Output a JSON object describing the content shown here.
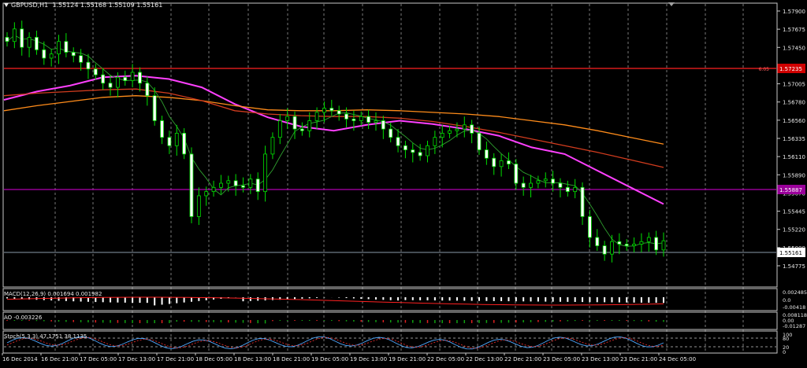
{
  "symbol_label": "GBPUSD,H1",
  "ohlc": "1.55124 1.55168 1.55109 1.55161",
  "colors": {
    "background": "#000000",
    "grid": "#c8c8c8",
    "candle_up": "#00e000",
    "candle_down": "#ffffff",
    "ma_magenta": "#ff40ff",
    "ma_orange": "#ff8c1a",
    "ma_red": "#d23c1e",
    "ma_green": "#2fa02f",
    "hline_red": "#ff2020",
    "hline_purple": "#b000b0",
    "hline_current": "#8a9aa8"
  },
  "price_axis": {
    "ticks": [
      "1.57900",
      "1.57675",
      "1.57450",
      "1.57225",
      "1.57005",
      "1.56780",
      "1.56560",
      "1.56335",
      "1.56110",
      "1.55890",
      "1.55670",
      "1.55445",
      "1.55220",
      "1.55000",
      "1.54775"
    ],
    "hline_red_label": "1.57235",
    "hline_red_small": "6.05",
    "hline_purple_label": "1.55887",
    "current_label": "1.55161"
  },
  "time_axis": {
    "labels": [
      "16 Dec 2014",
      "16 Dec 21:00",
      "17 Dec 05:00",
      "17 Dec 13:00",
      "17 Dec 21:00",
      "18 Dec 05:00",
      "18 Dec 13:00",
      "18 Dec 21:00",
      "19 Dec 05:00",
      "19 Dec 13:00",
      "19 Dec 21:00",
      "22 Dec 05:00",
      "22 Dec 13:00",
      "22 Dec 21:00",
      "23 Dec 05:00",
      "23 Dec 13:00",
      "23 Dec 21:00",
      "24 Dec 05:00"
    ]
  },
  "indicators": {
    "macd": {
      "label": "MACD(12,26,9) 0.001694 0.001982",
      "ticks": [
        "0.002485",
        "0.0",
        "-0.00418"
      ]
    },
    "ao": {
      "label": "AO -0.003226",
      "ticks": [
        "0.008118",
        "0.00",
        "-0.01287"
      ]
    },
    "stoch": {
      "label": "Stoch(5,3,3) 47.1751 38.1135",
      "ticks": [
        "100",
        "80",
        "20",
        "0"
      ]
    }
  },
  "chart_data": {
    "type": "candlestick",
    "symbol": "GBPUSD",
    "timeframe": "H1",
    "ylim": [
      1.547,
      1.58
    ],
    "close": [
      1.5755,
      1.577,
      1.5748,
      1.576,
      1.5745,
      1.5735,
      1.574,
      1.5755,
      1.5742,
      1.5738,
      1.573,
      1.5722,
      1.5715,
      1.5705,
      1.57,
      1.5712,
      1.5708,
      1.5718,
      1.5705,
      1.569,
      1.566,
      1.564,
      1.563,
      1.5645,
      1.562,
      1.5545,
      1.557,
      1.5575,
      1.558,
      1.5585,
      1.5588,
      1.5582,
      1.558,
      1.559,
      1.5575,
      1.562,
      1.564,
      1.566,
      1.5665,
      1.565,
      1.5648,
      1.566,
      1.567,
      1.5675,
      1.5672,
      1.5668,
      1.5662,
      1.566,
      1.5665,
      1.5658,
      1.566,
      1.565,
      1.564,
      1.563,
      1.5625,
      1.5622,
      1.5618,
      1.563,
      1.564,
      1.5645,
      1.5648,
      1.565,
      1.5655,
      1.5645,
      1.5625,
      1.5615,
      1.5605,
      1.5612,
      1.5608,
      1.5585,
      1.558,
      1.5585,
      1.5588,
      1.559,
      1.5585,
      1.558,
      1.5575,
      1.558,
      1.5545,
      1.552,
      1.551,
      1.55,
      1.5515,
      1.5512,
      1.551,
      1.5512,
      1.5515,
      1.552,
      1.5505,
      1.5516
    ],
    "ma_series": [
      {
        "name": "",
        "color": "#ff40ff",
        "values": [
          1.5685,
          1.5695,
          1.5702,
          1.5712,
          1.5714,
          1.571,
          1.57,
          1.568,
          1.5664,
          1.5653,
          1.5648,
          1.5655,
          1.566,
          1.5656,
          1.565,
          1.5642,
          1.5628,
          1.562,
          1.56,
          1.558,
          1.556
        ]
      },
      {
        "name": "",
        "color": "#ff8c1a",
        "values": [
          1.5672,
          1.5678,
          1.5683,
          1.5688,
          1.569,
          1.5688,
          1.5684,
          1.5678,
          1.5673,
          1.5672,
          1.5672,
          1.5673,
          1.5672,
          1.567,
          1.5668,
          1.5665,
          1.566,
          1.5655,
          1.5648,
          1.564,
          1.5632
        ]
      },
      {
        "name": "",
        "color": "#d23c1e",
        "values": [
          1.569,
          1.5693,
          1.5695,
          1.5697,
          1.5698,
          1.5693,
          1.5684,
          1.5672,
          1.5668,
          1.5666,
          1.5665,
          1.5665,
          1.5663,
          1.5659,
          1.5653,
          1.5646,
          1.5638,
          1.563,
          1.5622,
          1.5613,
          1.5604
        ]
      }
    ],
    "hlines": [
      1.57235,
      1.55887,
      1.55161
    ]
  }
}
